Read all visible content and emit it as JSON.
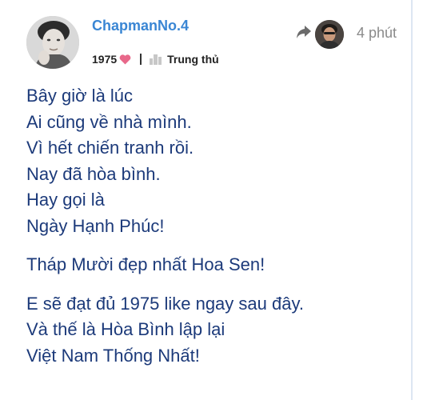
{
  "post": {
    "username": "ChapmanNo.4",
    "user_title": "1975",
    "badge_label": "Trung thủ",
    "time_ago": "4 phút",
    "paragraphs": [
      "Bây giờ là lúc\nAi cũng về nhà mình.\nVì hết chiến tranh rồi.\nNay đã hòa bình.\nHay gọi là\nNgày Hạnh Phúc!",
      "Tháp Mười đẹp nhất Hoa Sen!",
      "E sẽ đạt đủ 1975 like ngay sau đây.\nVà thế là Hòa Bình lập lại\nViệt Nam Thống Nhất!"
    ]
  },
  "icons": {
    "heart": "heart-icon",
    "badge": "badge-icon",
    "reply": "reply-arrow-icon"
  },
  "colors": {
    "username": "#3a86d4",
    "body_text": "#1c3a7a",
    "heart": "#e8688a",
    "time": "#8a8a8a"
  }
}
